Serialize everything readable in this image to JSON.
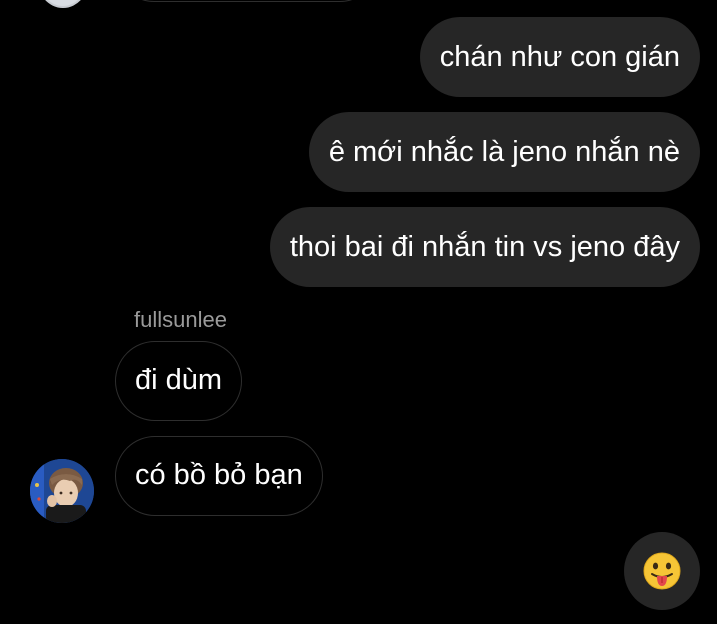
{
  "conversation": {
    "sent_messages": [
      {
        "text": "chán như con gián"
      },
      {
        "text": "ê mới nhắc là jeno nhắn nè"
      },
      {
        "text": "thoi bai đi nhắn tin vs jeno đây"
      }
    ],
    "received_group": {
      "sender": "fullsunlee",
      "messages": [
        {
          "text": "đi dùm"
        },
        {
          "text": "có bồ bỏ bạn"
        }
      ]
    }
  },
  "quick_reaction": {
    "icon": "face-with-tongue-icon"
  },
  "colors": {
    "background": "#000000",
    "sent_bubble": "#262626",
    "received_border": "#2e2e2e",
    "sender_name": "#9a9a9a"
  }
}
